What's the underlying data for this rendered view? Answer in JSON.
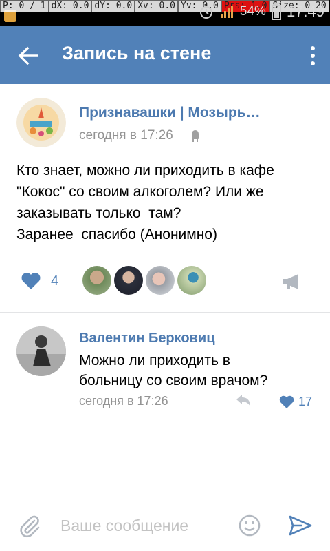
{
  "status_bar": {
    "debug": [
      "P: 0 / 1",
      "dX: 0.0",
      "dY: 0.0",
      "Xv: 0.0",
      "Yv: 0.0",
      "Prs: 1.0",
      "Size: 0.20"
    ],
    "battery": "54%",
    "clock": "17:49"
  },
  "app_bar": {
    "title": "Запись на стене"
  },
  "post": {
    "author": "Признавашки | Мозырь…",
    "time": "сегодня в 17:26",
    "text_lines": [
      "Кто знает, можно ли приходить в кафе",
      "\"Кокос\" со своим алкоголем? Или же",
      "заказывать только  там?",
      "Заранее  спасибо (Анонимно)"
    ],
    "likes": "4"
  },
  "comment": {
    "author": "Валентин Берковиц",
    "text_lines": [
      "Можно ли приходить в",
      "больницу со своим врачом?"
    ],
    "time": "сегодня в 17:26",
    "likes": "17"
  },
  "composer": {
    "placeholder": "Ваше сообщение"
  },
  "colors": {
    "brand": "#5181b8",
    "link": "#4d7ab0",
    "meta": "#939393"
  }
}
